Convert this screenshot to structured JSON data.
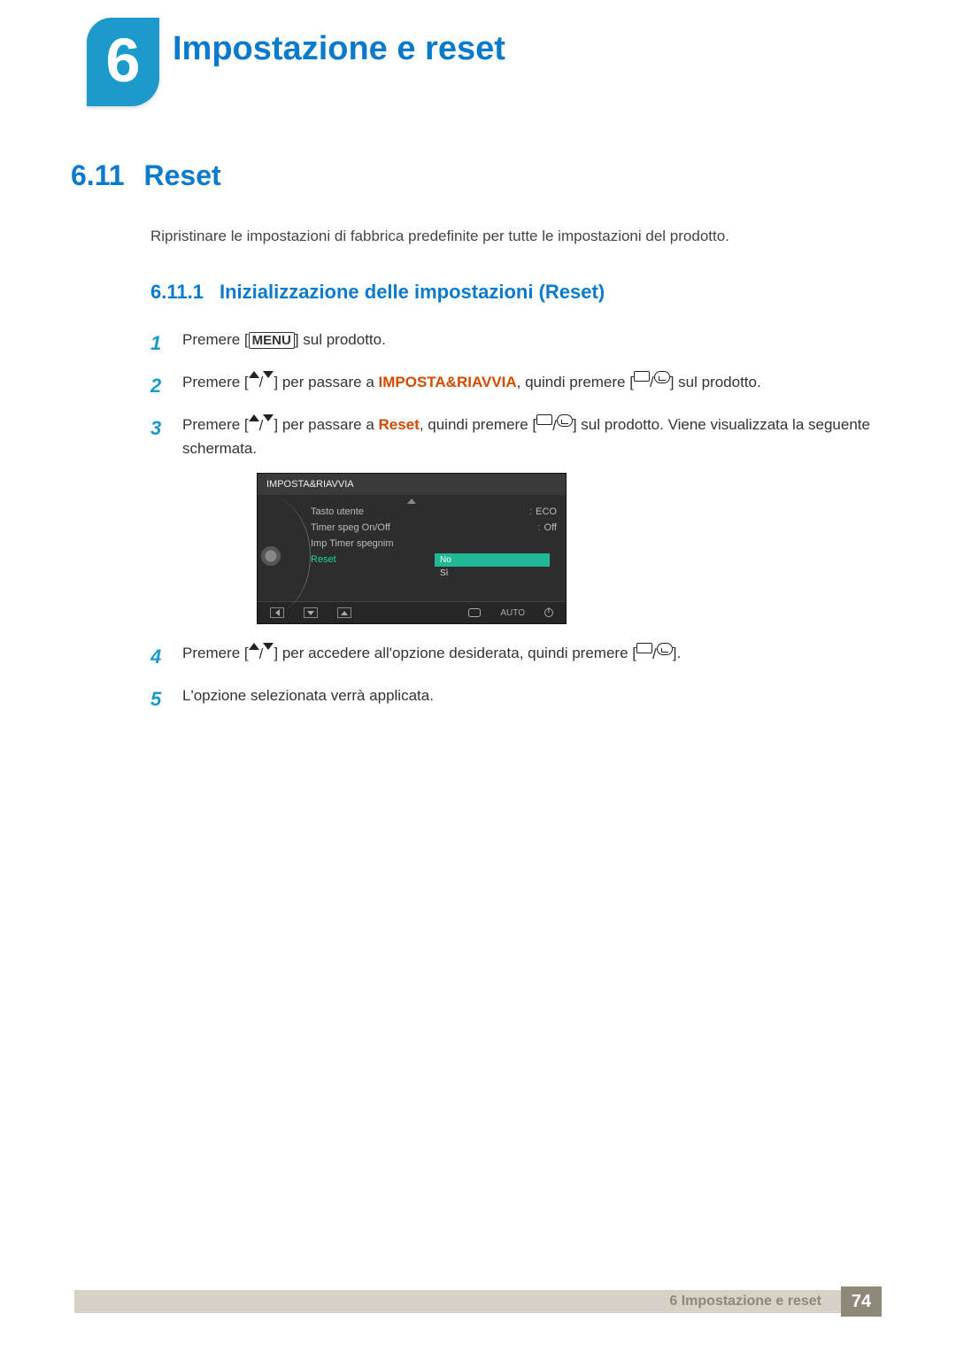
{
  "chapter": {
    "number": "6",
    "title": "Impostazione e reset"
  },
  "section": {
    "number": "6.11",
    "title": "Reset",
    "description": "Ripristinare le impostazioni di fabbrica predefinite per tutte le impostazioni del prodotto."
  },
  "subsection": {
    "number": "6.11.1",
    "title": "Inizializzazione delle impostazioni (Reset)"
  },
  "steps": {
    "s1": {
      "num": "1",
      "pre": "Premere [",
      "menu": "MENU",
      "post": "] sul prodotto."
    },
    "s2": {
      "num": "2",
      "pre": "Premere [",
      "mid": "] per passare a ",
      "target": "IMPOSTA&RIAVVIA",
      "mid2": ", quindi premere [",
      "post": "] sul prodotto."
    },
    "s3": {
      "num": "3",
      "pre": "Premere [",
      "mid": "] per passare a ",
      "target": "Reset",
      "mid2": ", quindi premere [",
      "post": "] sul prodotto. Viene visualizzata la seguente schermata."
    },
    "s4": {
      "num": "4",
      "pre": "Premere [",
      "mid": "] per accedere all'opzione desiderata, quindi premere [",
      "post": "]."
    },
    "s5": {
      "num": "5",
      "text": "L'opzione selezionata verrà applicata."
    }
  },
  "osd": {
    "title": "IMPOSTA&RIAVVIA",
    "rows": [
      {
        "label": "Tasto utente",
        "value": "ECO"
      },
      {
        "label": "Timer speg On/Off",
        "value": "Off"
      },
      {
        "label": "Imp Timer spegnim",
        "value": ""
      }
    ],
    "reset_label": "Reset",
    "options": {
      "no": "No",
      "si": "Sì"
    },
    "auto": "AUTO"
  },
  "footer": {
    "text": "6 Impostazione e reset",
    "page": "74"
  }
}
